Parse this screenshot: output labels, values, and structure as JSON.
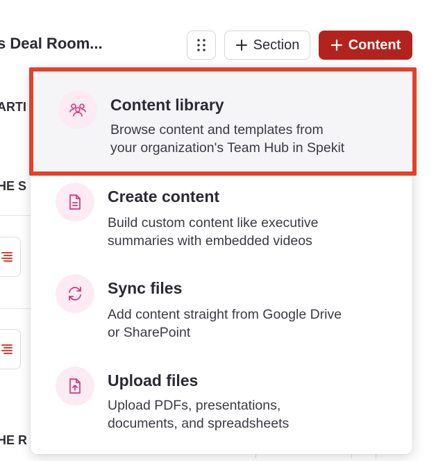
{
  "header": {
    "title": "s Deal Room...",
    "section_label": "Section",
    "content_label": "Content"
  },
  "background": {
    "frag1": "ARTI",
    "frag2": "HE S",
    "frag3": "HE R"
  },
  "menu": {
    "items": [
      {
        "title": "Content library",
        "desc_line1": "Browse content and templates from",
        "desc_line2": "your organization's Team Hub in Spekit"
      },
      {
        "title": "Create content",
        "desc_line1": "Build custom content like executive",
        "desc_line2": "summaries with embedded videos"
      },
      {
        "title": "Sync files",
        "desc_line1": "Add content straight from Google Drive",
        "desc_line2": "or SharePoint"
      },
      {
        "title": "Upload files",
        "desc_line1": "Upload PDFs, presentations,",
        "desc_line2": "documents, and spreadsheets"
      }
    ]
  },
  "colors": {
    "accent": "#b3231e",
    "icon_pink": "#d6337f",
    "highlight_border": "#e4402a"
  }
}
